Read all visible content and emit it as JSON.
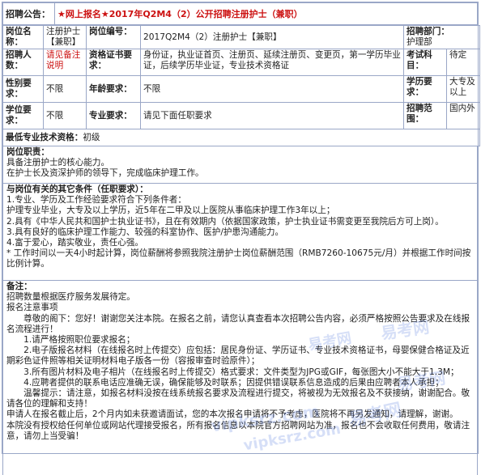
{
  "header": {
    "label": "招聘公告：",
    "title": "★网上报名★2017年Q2M4（2）公开招聘注册护士（兼职）"
  },
  "rows": {
    "post_name_label": "岗位名称：",
    "post_name_value": "注册护士【兼职】",
    "post_code_label": "岗位编号：",
    "post_code_value": "2017Q2M4（2）注册护士【兼职】",
    "dept_label": "招聘部门：",
    "dept_value": "护理部",
    "count_label": "招聘人数：",
    "count_value": "请见备注说明",
    "cert_label": "资格证书要求：",
    "cert_value": "身份证，执业证首页、注册页、延续注册页、变更页，第一学历毕业证，后续学历毕业证，专业技术资格证",
    "exam_label": "考试科目：",
    "exam_value": "待定",
    "gender_label": "性别要求：",
    "gender_value": "不限",
    "age_label": "年龄要求：",
    "age_value": "不限",
    "edu_label": "学历要求：",
    "edu_value": "大专及以上",
    "degree_label": "学位要求：",
    "degree_value": "不限",
    "major_label": "专业要求：",
    "major_value": "请见下面任职要求",
    "scope_label": "招聘范围：",
    "scope_value": "国内外"
  },
  "qualification": {
    "label": "最低专业技术资格：",
    "value": "初级"
  },
  "duties": {
    "title": "岗位职责：",
    "lines": [
      "具备注册护士的核心能力。",
      "在护士长及资深护师的领导下，完成临床护理工作。"
    ]
  },
  "conditions": {
    "title": "与岗位有关的其它条件（任职要求）：",
    "lines": [
      "1.专业、学历及工作经验要求符合下列条件者：",
      "护理专业毕业，大专及以上学历，近5年在二甲及以上医院从事临床护理工作3年以上；",
      "2.具有《中华人民共和国护士执业证书》，且在有效期内（依据国家政策，护士执业证书需变更至我院后方可上岗）。",
      "3.具有良好的临床护理工作能力、较强的科室协作、医护/护患沟通能力。",
      "4.富于爱心，踏实敬业，责任心强。",
      "* 工作时间以一天4小时起计算，岗位薪酬将参照我院注册护士岗位薪酬范围（RMB7260-10675元/月）并根据工作时间按比例计算。"
    ]
  },
  "notes": {
    "title": "备注：",
    "lines": [
      "招聘数量根据医疗服务发展待定。",
      "报名注意事项",
      "　　尊敬的阁下：您好！谢谢您关注本院。在报名之前，请您认真查看本次招聘公告内容，必须严格按照公告要求及在线报名流程进行！",
      "　　1.请严格按照职位要求报名；",
      "　　2.电子版报名材料（在线报名时上传提交）应包括：居民身份证、学历证书、专业技术资格证书，母婴保健合格证及近期彩色证件照等相关证明材料电子版各一份（容报审查时验原件）；",
      "　　3.所有图片材料及电子相片（在线报名时上传提交）格式要求：文件类型为JPG或GIF，每张图大小不能大于1.3M；",
      "　　4.应聘者提供的联系电话应准确无误，确保能够及时联系；因提供错误联系信息造成的后果由应聘者本人承担；",
      "　　温馨提示：请注意，如报名材料没按在线系统报名要求及流程进行提交，将被视为无效报名及不获接纳，谢谢配合。敬请各位的理解和支持！",
      "申请人在报名截止后，2个月内如未获邀请面试，您的本次报名申请将不予考虑，医院将不再另发通知，请理解，谢谢。",
      "本院没有授权给任何单位或网站代理接受报名，所有报名信息以本院官方招聘网站为准，报名也不会收取任何费用，敬请注意，请勿上当受骗！"
    ]
  },
  "watermarks": [
    "易考网",
    "易考网",
    "易考网",
    "vipksrz.com",
    "vipksrz.com",
    "易考网"
  ]
}
